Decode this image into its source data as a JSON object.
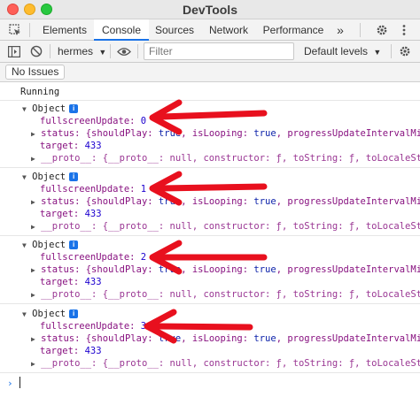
{
  "window": {
    "title": "DevTools"
  },
  "tabs": [
    {
      "label": "Elements"
    },
    {
      "label": "Console",
      "active": true
    },
    {
      "label": "Sources"
    },
    {
      "label": "Network"
    },
    {
      "label": "Performance"
    },
    {
      "label": "»"
    }
  ],
  "toolbar": {
    "context": "hermes",
    "filter_placeholder": "Filter",
    "levels": "Default levels"
  },
  "issues": {
    "label": "No Issues"
  },
  "console": {
    "running": "Running",
    "messages": [
      {
        "label": "Object",
        "fullscreen_key": "fullscreenUpdate:",
        "fullscreen_value": "0",
        "status_text": "status: {shouldPlay: true, isLooping: true, progressUpdateIntervalMi",
        "target_key": "target:",
        "target_value": "433",
        "proto_text": "__proto__: {__proto__: null, constructor: ƒ, toString: ƒ, toLocaleSt"
      },
      {
        "label": "Object",
        "fullscreen_key": "fullscreenUpdate:",
        "fullscreen_value": "1",
        "status_text": "status: {shouldPlay: true, isLooping: true, progressUpdateIntervalMi",
        "target_key": "target:",
        "target_value": "433",
        "proto_text": "__proto__: {__proto__: null, constructor: ƒ, toString: ƒ, toLocaleSt"
      },
      {
        "label": "Object",
        "fullscreen_key": "fullscreenUpdate:",
        "fullscreen_value": "2",
        "status_text": "status: {shouldPlay: true, isLooping: true, progressUpdateIntervalMi",
        "target_key": "target:",
        "target_value": "433",
        "proto_text": "__proto__: {__proto__: null, constructor: ƒ, toString: ƒ, toLocaleSt"
      },
      {
        "label": "Object",
        "fullscreen_key": "fullscreenUpdate:",
        "fullscreen_value": "3",
        "status_text": "status: {shouldPlay: true, isLooping: true, progressUpdateIntervalMi",
        "target_key": "target:",
        "target_value": "433",
        "proto_text": "__proto__: {__proto__: null, constructor: ƒ, toString: ƒ, toLocaleSt"
      }
    ],
    "prompt": "›"
  },
  "annotation_color": "#e8101e"
}
